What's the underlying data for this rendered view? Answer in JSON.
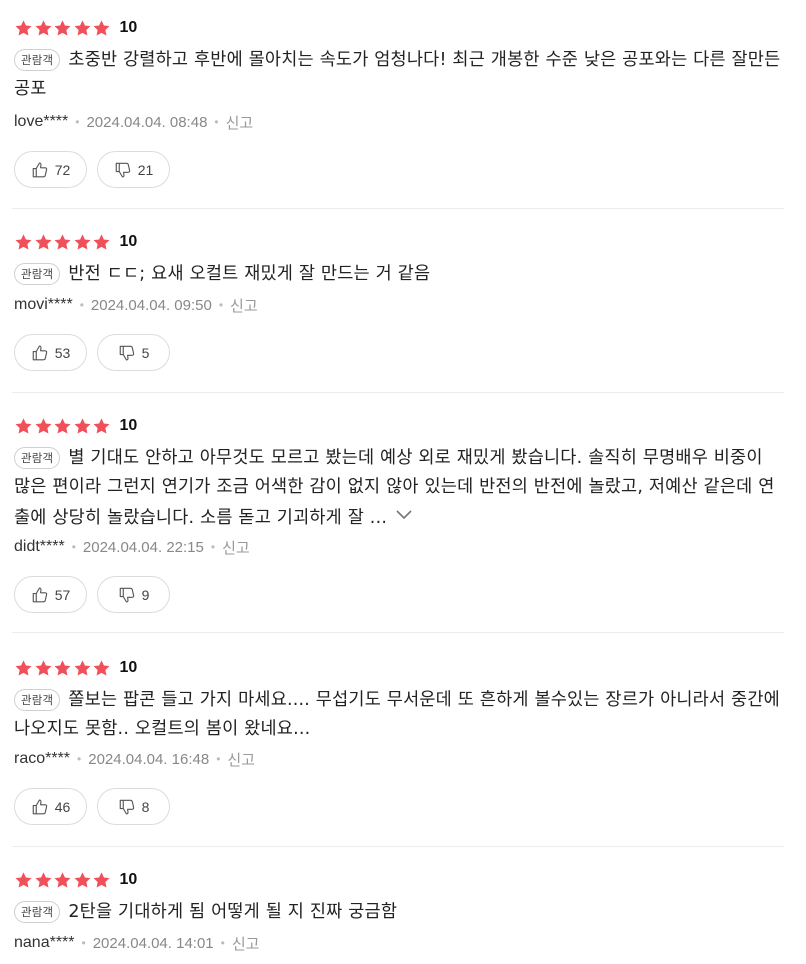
{
  "reviews": [
    {
      "score": "10",
      "badge": "관람객",
      "text": "초중반 강렬하고 후반에 몰아치는 속도가 엄청나다! 최근 개봉한 수준 낮은 공포와는 다른 잘만든 공포",
      "user": "love****",
      "date": "2024.04.04. 08:48",
      "report": "신고",
      "likes": "72",
      "dislikes": "21"
    },
    {
      "score": "10",
      "badge": "관람객",
      "text": "반전 ㄷㄷ; 요새 오컬트 재밌게 잘 만드는 거 같음",
      "user": "movi****",
      "date": "2024.04.04. 09:50",
      "report": "신고",
      "likes": "53",
      "dislikes": "5"
    },
    {
      "score": "10",
      "badge": "관람객",
      "text": "별 기대도 안하고 아무것도 모르고 봤는데 예상 외로 재밌게 봤습니다. 솔직히 무명배우 비중이 많은 편이라 그런지 연기가 조금 어색한 감이 없지 않아 있는데 반전의 반전에 놀랐고, 저예산 같은데 연출에 상당히 놀랐습니다. 소름 돋고 기괴하게 잘 ...",
      "user": "didt****",
      "date": "2024.04.04. 22:15",
      "report": "신고",
      "likes": "57",
      "dislikes": "9"
    },
    {
      "score": "10",
      "badge": "관람객",
      "text": "쫄보는 팝콘 들고 가지 마세요.... 무섭기도 무서운데 또 흔하게 볼수있는 장르가 아니라서 중간에 나오지도 못함.. 오컬트의 봄이 왔네요...",
      "user": "raco****",
      "date": "2024.04.04. 16:48",
      "report": "신고",
      "likes": "46",
      "dislikes": "8"
    },
    {
      "score": "10",
      "badge": "관람객",
      "text": "2탄을 기대하게 됨 어떻게 될 지 진짜 궁금함",
      "user": "nana****",
      "date": "2024.04.04. 14:01",
      "report": "신고"
    }
  ],
  "colors": {
    "star": "#f0505a",
    "muted": "#888888",
    "border": "#dcdcdc"
  },
  "icons": {
    "star": "star-icon",
    "like": "thumbs-up-icon",
    "dislike": "thumbs-down-icon",
    "more": "chevron-down-icon"
  }
}
